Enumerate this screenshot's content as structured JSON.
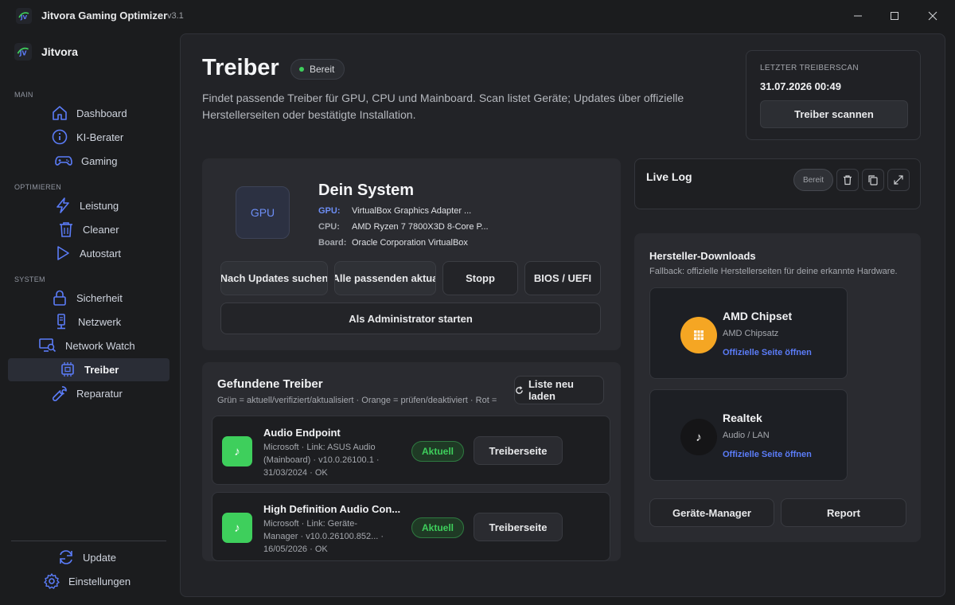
{
  "titlebar": {
    "title": "Jitvora Gaming Optimizer",
    "version": "v3.1"
  },
  "sidebar": {
    "brand": "Jitvora",
    "sections": {
      "main": "MAIN",
      "optimize": "OPTIMIEREN",
      "system": "SYSTEM"
    },
    "items": {
      "dashboard": "Dashboard",
      "ki_berater": "KI-Berater",
      "gaming": "Gaming",
      "leistung": "Leistung",
      "cleaner": "Cleaner",
      "autostart": "Autostart",
      "sicherheit": "Sicherheit",
      "netzwerk": "Netzwerk",
      "network_watch": "Network Watch",
      "treiber": "Treiber",
      "reparatur": "Reparatur",
      "update": "Update",
      "einstellungen": "Einstellungen"
    },
    "active": "treiber"
  },
  "header": {
    "title": "Treiber",
    "status": "Bereit",
    "description": "Findet passende Treiber für GPU, CPU und Mainboard. Scan listet Geräte; Updates über offizielle Herstellerseiten oder bestätigte Installation."
  },
  "scan": {
    "label": "LETZTER TREIBERSCAN",
    "date": "31.07.2026 00:49",
    "button": "Treiber scannen"
  },
  "system": {
    "icon_label": "GPU",
    "title": "Dein System",
    "rows": [
      {
        "key": "GPU:",
        "value": "VirtualBox Graphics Adapter ...",
        "color": "#6d8ef5"
      },
      {
        "key": "CPU:",
        "value": "AMD Ryzen 7 7800X3D 8-Core P...",
        "color": "#a5a8ae"
      },
      {
        "key": "Board:",
        "value": "Oracle Corporation VirtualBox",
        "color": "#a5a8ae"
      }
    ],
    "buttons": {
      "search_updates": "Nach Updates suchen",
      "update_all": "Alle passenden aktua",
      "stop": "Stopp",
      "bios": "BIOS / UEFI",
      "admin": "Als Administrator starten"
    }
  },
  "drivers": {
    "title": "Gefundene Treiber",
    "subtitle": "Grün = aktuell/verifiziert/aktualisiert · Orange = prüfen/deaktiviert · Rot =",
    "reload": "Liste neu laden",
    "items": [
      {
        "name": "Audio Endpoint",
        "meta": "Microsoft · Link: ASUS Audio (Mainboard) · v10.0.26100.1 · 31/03/2024 · OK",
        "status": "Aktuell",
        "action": "Treiberseite"
      },
      {
        "name": "High Definition Audio Con...",
        "meta": "Microsoft · Link: Geräte-Manager · v10.0.26100.852... · 16/05/2026 · OK",
        "status": "Aktuell",
        "action": "Treiberseite"
      }
    ]
  },
  "log": {
    "title": "Live Log",
    "status": "Bereit"
  },
  "manufacturers": {
    "title": "Hersteller-Downloads",
    "subtitle": "Fallback: offizielle Herstellerseiten für deine erkannte Hardware.",
    "items": [
      {
        "name": "AMD Chipset",
        "desc": "AMD Chipsatz",
        "link": "Offizielle Seite öffnen",
        "icon": "chip-icon",
        "color": "#f5a623"
      },
      {
        "name": "Realtek",
        "desc": "Audio / LAN",
        "link": "Offizielle Seite öffnen",
        "icon": "music-note-icon",
        "color": "#151517"
      }
    ],
    "buttons": {
      "device_manager": "Geräte-Manager",
      "report": "Report"
    }
  },
  "colors": {
    "accent": "#5b7cf8",
    "success": "#3ecf5c",
    "warning": "#f5a623",
    "background": "#1b1c1e",
    "panel": "#222327"
  }
}
